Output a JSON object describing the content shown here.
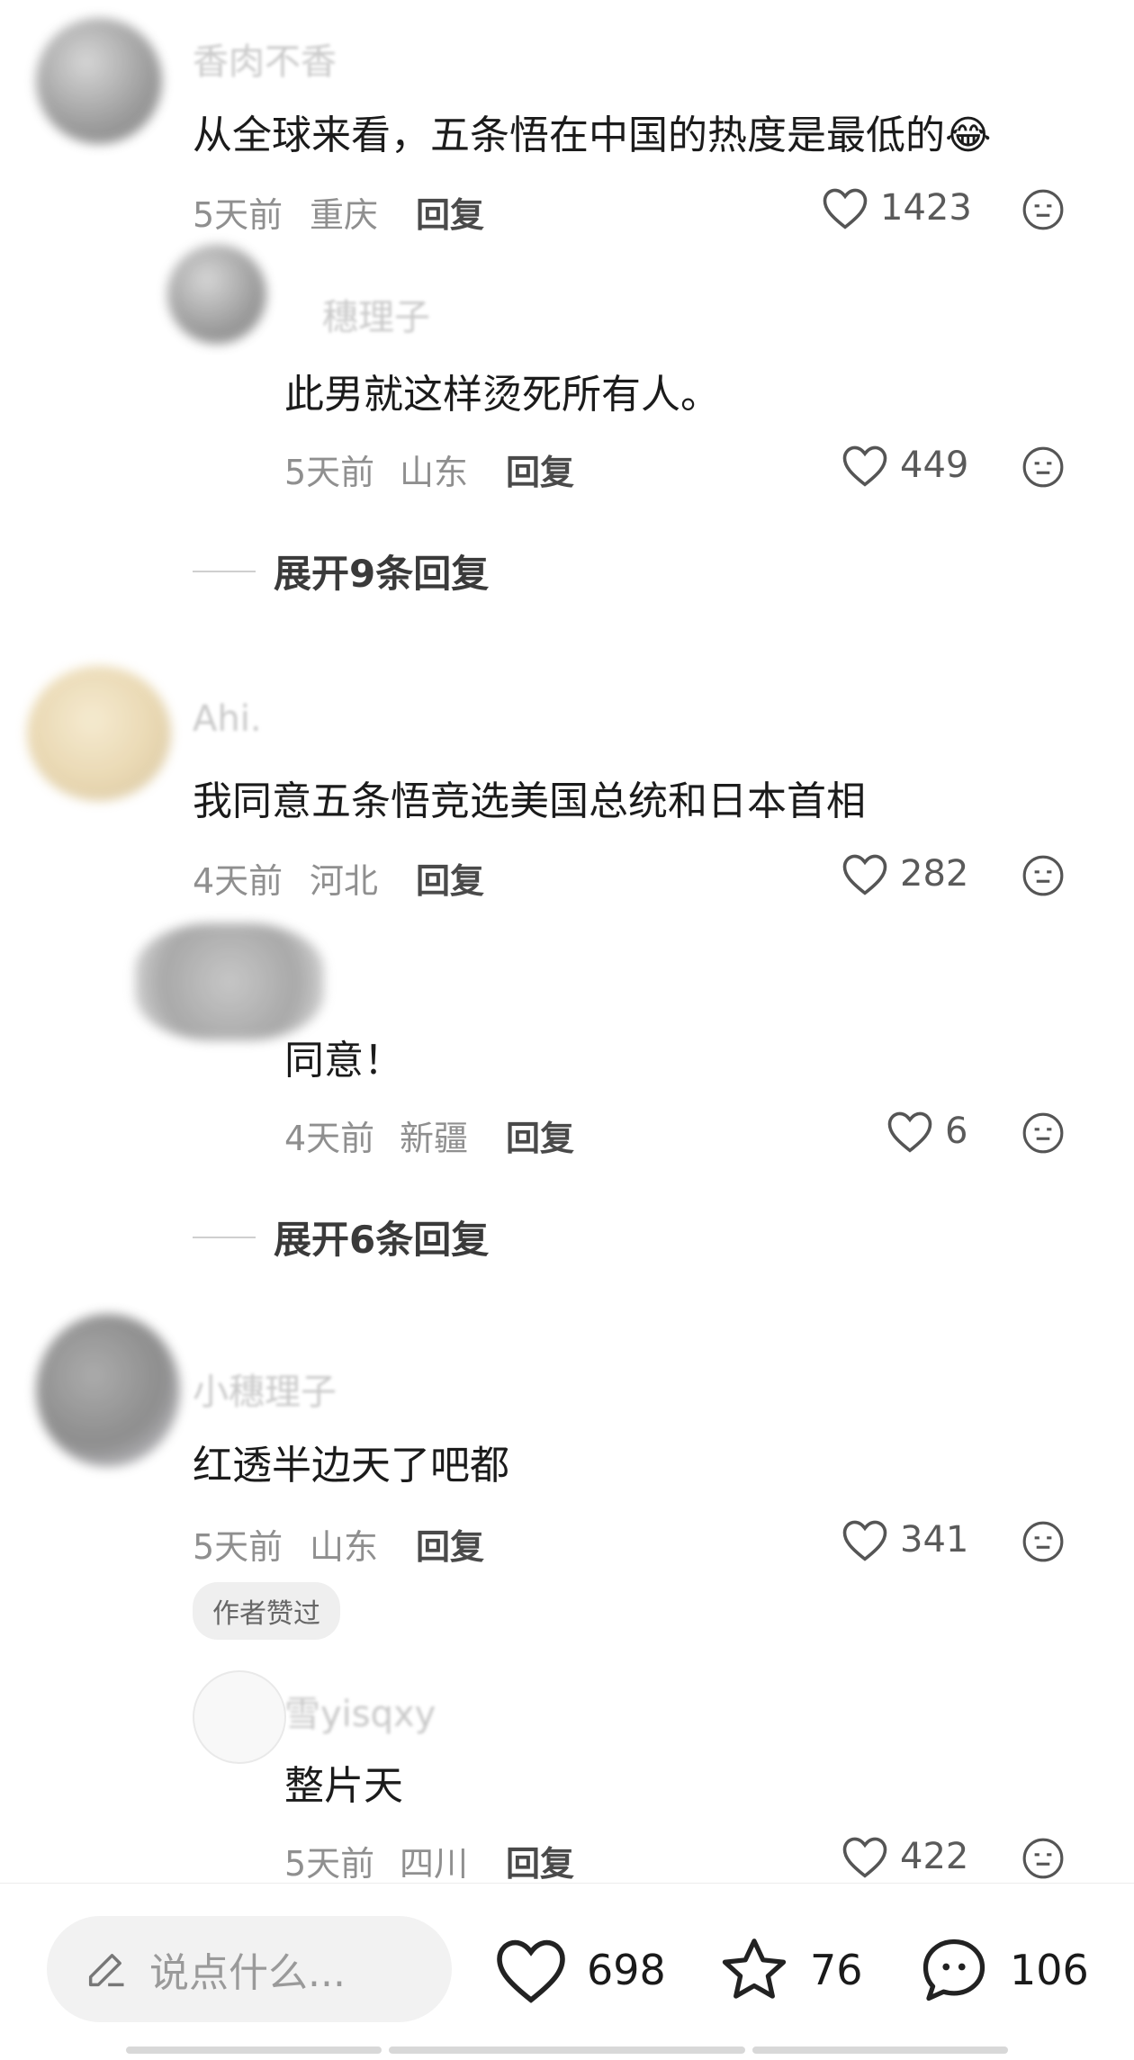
{
  "comments": [
    {
      "username": "香肉不香",
      "text": "从全球来看，五条悟在中国的热度是最低的😂",
      "time": "5天前",
      "location": "重庆",
      "reply_label": "回复",
      "likes": "1423"
    },
    {
      "username": "穗理子",
      "text": "此男就这样烫死所有人。",
      "time": "5天前",
      "location": "山东",
      "reply_label": "回复",
      "likes": "449"
    },
    {
      "username": "Ahi.",
      "text": "我同意五条悟竞选美国总统和日本首相",
      "time": "4天前",
      "location": "河北",
      "reply_label": "回复",
      "likes": "282"
    },
    {
      "username": "",
      "text": "同意！",
      "time": "4天前",
      "location": "新疆",
      "reply_label": "回复",
      "likes": "6"
    },
    {
      "username": "小穗理子",
      "text": "红透半边天了吧都",
      "time": "5天前",
      "location": "山东",
      "reply_label": "回复",
      "likes": "341",
      "badge": "作者赞过"
    },
    {
      "username": "雪yisqxy",
      "text": "整片天",
      "time": "5天前",
      "location": "四川",
      "reply_label": "回复",
      "likes": "422"
    }
  ],
  "expand": [
    "展开9条回复",
    "展开6条回复"
  ],
  "bottom_bar": {
    "input_placeholder": "说点什么...",
    "likes": "698",
    "favorites": "76",
    "comments": "106"
  },
  "icons": {
    "like": "heart-outline-icon",
    "react": "emoji-face-icon",
    "edit": "pencil-icon",
    "favorite": "star-outline-icon",
    "comment": "chat-bubble-icon"
  }
}
